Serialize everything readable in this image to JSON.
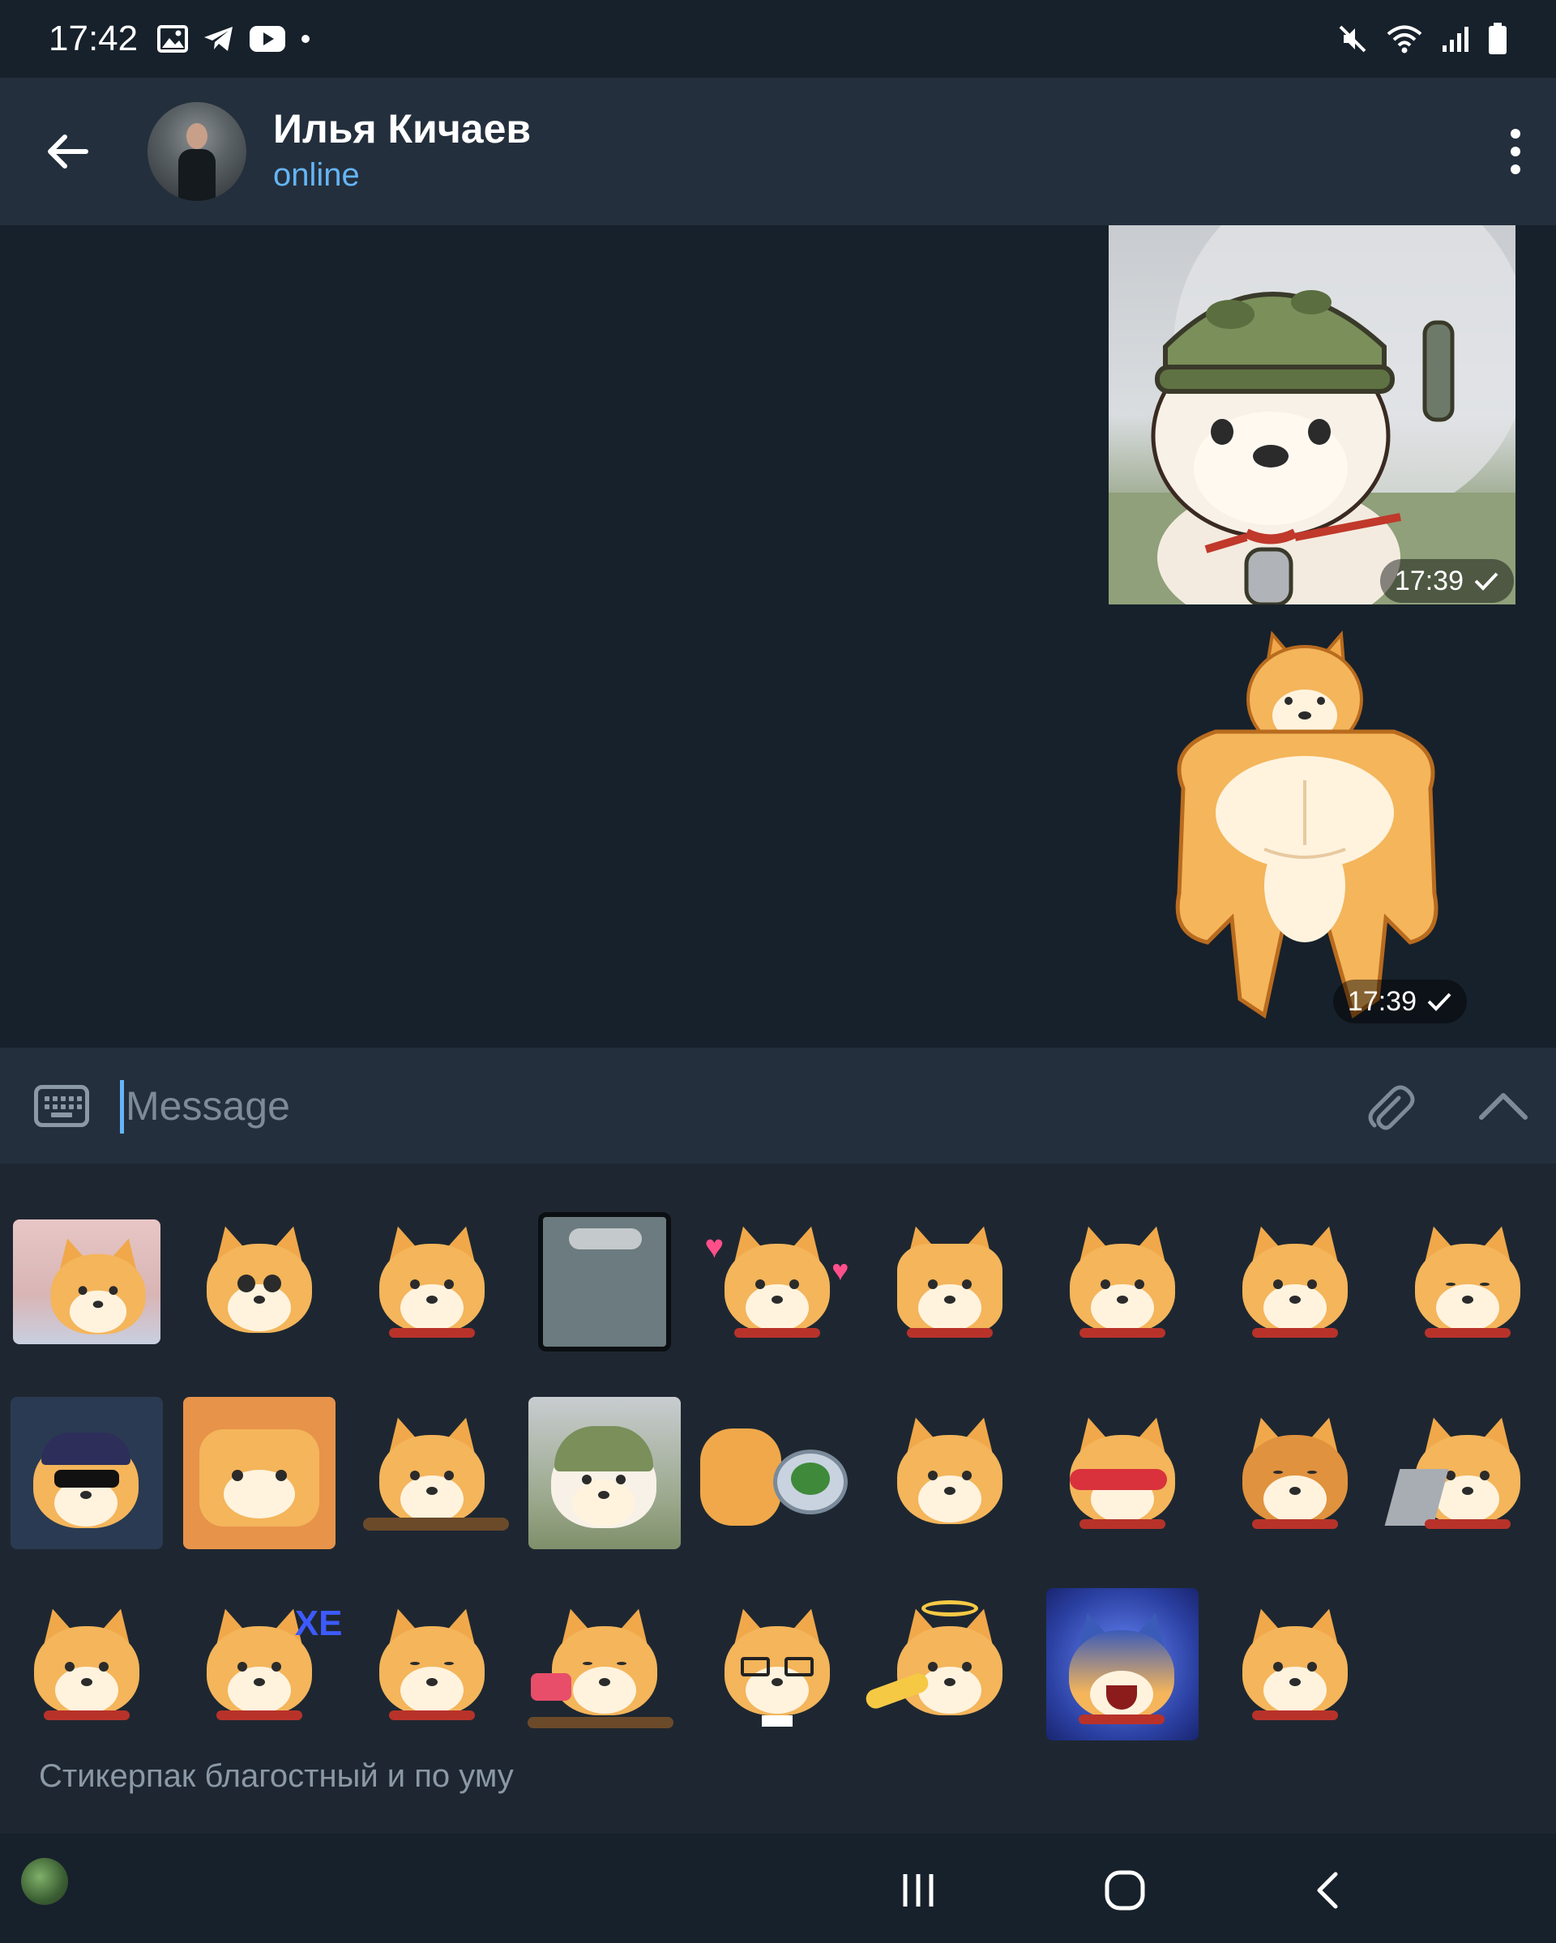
{
  "status_bar": {
    "time": "17:42",
    "left_icons": [
      "gallery-icon",
      "telegram-icon",
      "youtube-icon",
      "dot-icon"
    ],
    "right_icons": [
      "mute-icon",
      "wifi-icon",
      "signal-icon",
      "battery-icon"
    ]
  },
  "header": {
    "title": "Илья Кичаев",
    "status": "online",
    "back_icon": "arrow-left-icon",
    "menu_icon": "more-vertical-icon"
  },
  "messages": [
    {
      "type": "sticker",
      "description": "doge in army helmet",
      "time": "17:39",
      "status": "sent"
    },
    {
      "type": "sticker",
      "description": "muscular doge",
      "time": "17:39",
      "status": "sent"
    }
  ],
  "composer": {
    "placeholder": "Message",
    "value": "",
    "keyboard_icon": "keyboard-icon",
    "attach_icon": "paperclip-icon",
    "expand_icon": "chevron-up-icon"
  },
  "sticker_panel": {
    "pack_title": "Стикерпак благостный и по уму",
    "sticker_count": 26
  },
  "colors": {
    "background": "#17212b",
    "header": "#242f3d",
    "accent": "#64b5f6",
    "panel": "#1e2731",
    "muted": "#8b98a5"
  }
}
